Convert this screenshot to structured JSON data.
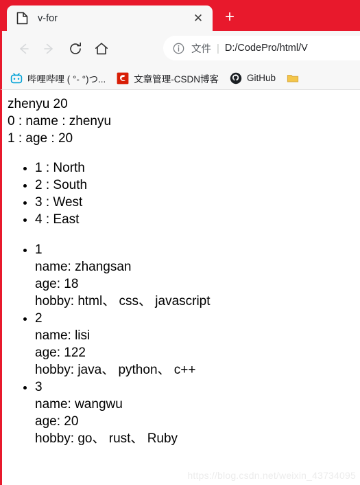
{
  "browser": {
    "accent_color": "#E8192C",
    "tab": {
      "title": "v-for",
      "favicon": "page-icon",
      "close_label": "✕"
    },
    "new_tab_label": "+",
    "nav": {
      "back": "←",
      "forward": "→",
      "reload": "↻",
      "home": "⌂"
    },
    "omnibox": {
      "info_icon": "info-circle-icon",
      "scheme_label": "文件",
      "separator": "|",
      "url": "D:/CodePro/html/V"
    },
    "bookmarks": [
      {
        "label": "哔哩哔哩 ( °- °)つ...",
        "icon": "bilibili-icon",
        "icon_color": "#00A1D6"
      },
      {
        "label": "文章管理-CSDN博客",
        "icon": "csdn-icon",
        "icon_color": "#D81E06"
      },
      {
        "label": "GitHub",
        "icon": "github-icon",
        "icon_color": "#1B1F23"
      },
      {
        "label": "",
        "icon": "folder-icon",
        "icon_color": "#F4C64A"
      }
    ]
  },
  "content": {
    "plain_lines": [
      "zhenyu 20",
      "0 : name : zhenyu",
      "1 : age : 20"
    ],
    "simple_list": [
      "1 : North",
      "2 : South",
      "3 : West",
      "4 : East"
    ],
    "records": [
      {
        "index": "1",
        "name": "name: zhangsan",
        "age": "age: 18",
        "hobby": "hobby: html、 css、 javascript"
      },
      {
        "index": "2",
        "name": "name: lisi",
        "age": "age: 122",
        "hobby": "hobby: java、 python、 c++"
      },
      {
        "index": "3",
        "name": "name: wangwu",
        "age": "age: 20",
        "hobby": "hobby: go、 rust、 Ruby"
      }
    ],
    "watermark": "https://blog.csdn.net/weixin_43734095"
  }
}
